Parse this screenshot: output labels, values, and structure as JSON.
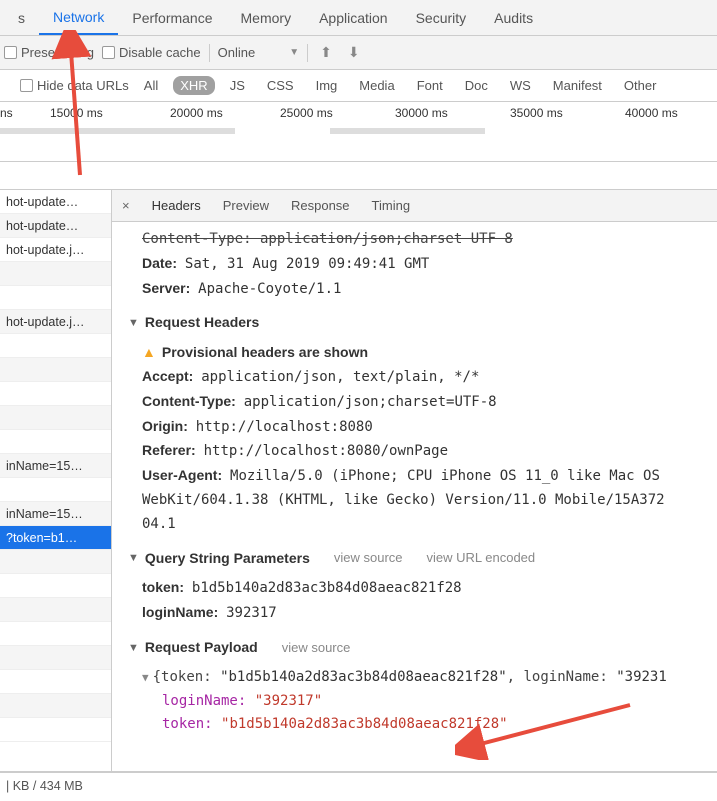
{
  "tabs": {
    "items": [
      "s",
      "Network",
      "Performance",
      "Memory",
      "Application",
      "Security",
      "Audits"
    ],
    "active_index": 1
  },
  "toolbar": {
    "preserve_log": "Preserve log",
    "disable_cache": "Disable cache",
    "throttling": "Online"
  },
  "filterbar": {
    "hide_data_urls": "Hide data URLs",
    "filters": [
      "All",
      "XHR",
      "JS",
      "CSS",
      "Img",
      "Media",
      "Font",
      "Doc",
      "WS",
      "Manifest",
      "Other"
    ],
    "active_index": 1
  },
  "timeline": {
    "unit_label_prefix": "ns",
    "ticks": [
      "15000 ms",
      "20000 ms",
      "25000 ms",
      "30000 ms",
      "35000 ms",
      "40000 ms"
    ]
  },
  "requests": [
    "hot-update…",
    "hot-update…",
    "hot-update.j…",
    "",
    "",
    "hot-update.j…",
    "",
    "",
    "",
    "",
    "",
    "inName=15…",
    "",
    "inName=15…",
    "?token=b1…"
  ],
  "selected_request_index": 14,
  "detail_tabs": {
    "items": [
      "Headers",
      "Preview",
      "Response",
      "Timing"
    ],
    "active_index": 0
  },
  "response_headers": {
    "truncated_first": "Content-Type: application/json;charset UTF 8",
    "rows": [
      {
        "k": "Date:",
        "v": "Sat, 31 Aug 2019 09:49:41 GMT"
      },
      {
        "k": "Server:",
        "v": "Apache-Coyote/1.1"
      }
    ]
  },
  "request_headers": {
    "title": "Request Headers",
    "provisional": "Provisional headers are shown",
    "rows": [
      {
        "k": "Accept:",
        "v": "application/json, text/plain, */*"
      },
      {
        "k": "Content-Type:",
        "v": "application/json;charset=UTF-8"
      },
      {
        "k": "Origin:",
        "v": "http://localhost:8080"
      },
      {
        "k": "Referer:",
        "v": "http://localhost:8080/ownPage"
      },
      {
        "k": "User-Agent:",
        "v": "Mozilla/5.0 (iPhone; CPU iPhone OS 11_0 like Mac OS ",
        "cont1": "WebKit/604.1.38 (KHTML, like Gecko) Version/11.0 Mobile/15A372",
        "cont2": "04.1"
      }
    ]
  },
  "query_string": {
    "title": "Query String Parameters",
    "aux1": "view source",
    "aux2": "view URL encoded",
    "rows": [
      {
        "k": "token:",
        "v": "b1d5b140a2d83ac3b84d08aeac821f28"
      },
      {
        "k": "loginName:",
        "v": "392317"
      }
    ]
  },
  "payload": {
    "title": "Request Payload",
    "aux1": "view source",
    "summary_prefix": "{token: ",
    "summary_token": "\"b1d5b140a2d83ac3b84d08aeac821f28\"",
    "summary_mid": ", loginName: ",
    "summary_login": "\"39231",
    "rows": [
      {
        "k": "loginName:",
        "v": "\"392317\""
      },
      {
        "k": "token:",
        "v": "\"b1d5b140a2d83ac3b84d08aeac821f28\""
      }
    ]
  },
  "footer": {
    "text": "| KB / 434 MB"
  }
}
